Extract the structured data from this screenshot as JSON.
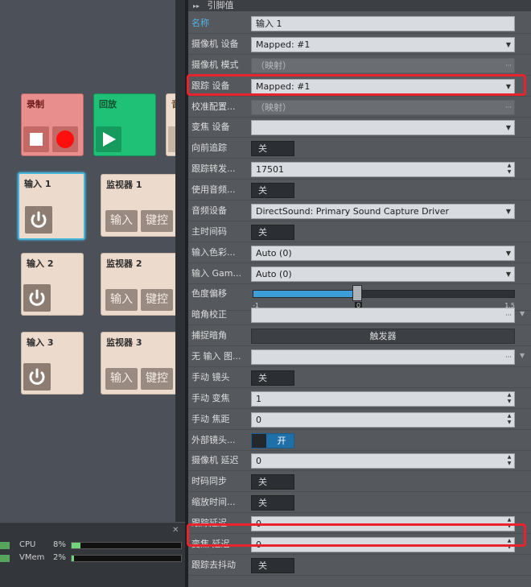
{
  "left": {
    "record": {
      "title": "录制"
    },
    "playback": {
      "title": "回放"
    },
    "partial_tile": {
      "title": "音"
    },
    "inputs": [
      {
        "title": "输入 1",
        "selected": true
      },
      {
        "title": "输入 2",
        "selected": false
      },
      {
        "title": "输入 3",
        "selected": false
      }
    ],
    "monitors": [
      {
        "title": "监视器 1",
        "btn_input": "输入",
        "btn_keyer": "键控"
      },
      {
        "title": "监视器 2",
        "btn_input": "输入",
        "btn_keyer": "键控"
      },
      {
        "title": "监视器 3",
        "btn_input": "输入",
        "btn_keyer": "键控"
      }
    ]
  },
  "status": {
    "close": "✕",
    "cpu_label": "CPU",
    "cpu_value": "8%",
    "cpu_fraction": 0.08,
    "vmem_label": "VMem",
    "vmem_value": "2%",
    "vmem_fraction": 0.02
  },
  "props": {
    "header": "引脚值",
    "rows": [
      {
        "label": "名称",
        "type": "text",
        "value": "输入 1",
        "blue": true
      },
      {
        "label": "摄像机 设备",
        "type": "dropdown",
        "value": "Mapped: #1"
      },
      {
        "label": "摄像机 模式",
        "type": "disabled-ellipsis",
        "value": "（映射）"
      },
      {
        "label": "跟踪 设备",
        "type": "dropdown",
        "value": "Mapped: #1"
      },
      {
        "label": "校准配置...",
        "type": "disabled-ellipsis",
        "value": "（映射）"
      },
      {
        "label": "变焦 设备",
        "type": "dropdown",
        "value": ""
      },
      {
        "label": "向前追踪",
        "type": "toggle",
        "value": "关"
      },
      {
        "label": "跟踪转发...",
        "type": "spin",
        "value": "17501"
      },
      {
        "label": "使用音频...",
        "type": "toggle",
        "value": "关"
      },
      {
        "label": "音频设备",
        "type": "dropdown",
        "value": "DirectSound: Primary Sound Capture Driver"
      },
      {
        "label": "主时间码",
        "type": "toggle",
        "value": "关"
      },
      {
        "label": "输入色彩...",
        "type": "dropdown",
        "value": "Auto (0)"
      },
      {
        "label": "输入 Gam...",
        "type": "dropdown",
        "value": "Auto (0)"
      },
      {
        "label": "色度偏移",
        "type": "slider",
        "value": "0",
        "min": "-1",
        "max": "1.5",
        "slider_value": 0
      },
      {
        "label": "暗角校正",
        "type": "ellipsis",
        "value": ""
      },
      {
        "label": "捕捉暗角",
        "type": "button",
        "value": "触发器"
      },
      {
        "label": "无 输入 图...",
        "type": "ellipsis",
        "value": ""
      },
      {
        "label": "手动 镜头",
        "type": "toggle",
        "value": "关"
      },
      {
        "label": "手动 变焦",
        "type": "spin",
        "value": "1"
      },
      {
        "label": "手动 焦距",
        "type": "spin",
        "value": "0"
      },
      {
        "label": "外部镜头...",
        "type": "toggle-on",
        "value": "开"
      },
      {
        "label": "摄像机 延迟",
        "type": "spin",
        "value": "0"
      },
      {
        "label": "时码同步",
        "type": "toggle",
        "value": "关"
      },
      {
        "label": "缩放时间...",
        "type": "toggle",
        "value": "关"
      },
      {
        "label": "跟踪延迟",
        "type": "spin",
        "value": "0"
      },
      {
        "label": "变焦 延迟",
        "type": "spin",
        "value": "0"
      },
      {
        "label": "跟踪去抖动",
        "type": "toggle",
        "value": "关"
      }
    ]
  },
  "colors": {
    "accent_blue": "#3d9ed7",
    "highlight_red": "#e8232b",
    "record_tile": "#e88e8c",
    "playback_tile": "#1fc177",
    "input_tile": "#ecdacc"
  }
}
